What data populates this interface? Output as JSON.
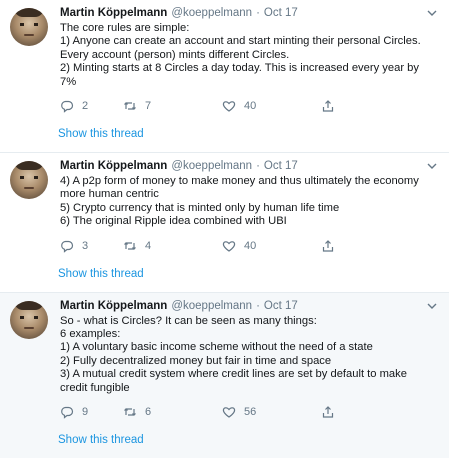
{
  "tweets": [
    {
      "author_name": "Martin Köppelmann",
      "handle": "@koeppelmann",
      "separator": "·",
      "date": "Oct 17",
      "text": "The core rules are simple:\n1) Anyone can create an account and start minting their personal Circles. Every account (person) mints different Circles.\n2) Minting starts at 8 Circles a day today. This is increased every year by 7%",
      "replies": "2",
      "retweets": "7",
      "likes": "40",
      "show_thread": "Show this thread"
    },
    {
      "author_name": "Martin Köppelmann",
      "handle": "@koeppelmann",
      "separator": "·",
      "date": "Oct 17",
      "text": "4) A p2p form of money to make money and thus ultimately the economy more human centric\n5) Crypto currency that is minted only by human life time\n6) The original Ripple idea combined with UBI",
      "replies": "3",
      "retweets": "4",
      "likes": "40",
      "show_thread": "Show this thread"
    },
    {
      "author_name": "Martin Köppelmann",
      "handle": "@koeppelmann",
      "separator": "·",
      "date": "Oct 17",
      "text": "So - what is Circles? It can be seen as many things:\n6 examples:\n1) A voluntary basic income scheme without the need of a state\n2) Fully decentralized money but fair in time and space\n3) A mutual credit system where credit lines are set by default to make credit fungible",
      "replies": "9",
      "retweets": "6",
      "likes": "56",
      "show_thread": "Show this thread"
    }
  ],
  "icons": {
    "reply": "reply-icon",
    "retweet": "retweet-icon",
    "like": "heart-icon",
    "share": "share-icon",
    "caret": "chevron-down-icon"
  },
  "colors": {
    "link": "#1b95e0",
    "muted": "#657786",
    "text": "#14171a",
    "alt_background": "#f5f8fa"
  }
}
